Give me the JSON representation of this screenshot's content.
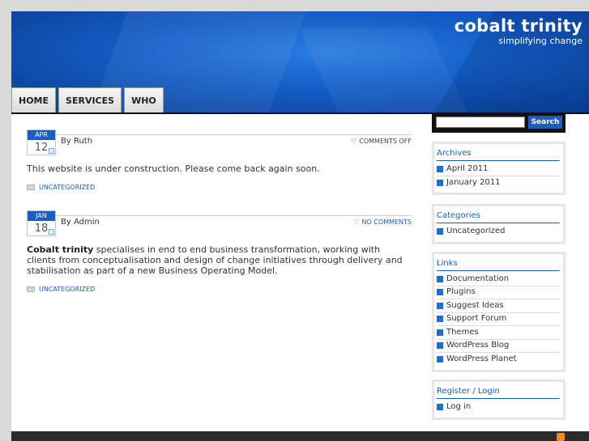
{
  "site": {
    "title": "cobalt trinity",
    "tagline": "simplifying change"
  },
  "nav": {
    "items": [
      "HOME",
      "SERVICES",
      "WHO"
    ]
  },
  "posts": [
    {
      "month": "APR",
      "day": "12",
      "author": "By Ruth",
      "comments": "COMMENTS OFF",
      "body": "This website is under construction.  Please come back again soon.",
      "category": "UNCATEGORIZED"
    },
    {
      "month": "JAN",
      "day": "18",
      "author": "By Admin",
      "comments": "NO COMMENTS",
      "body_bold": "Cobalt trinity",
      "body": " specialises in end to end business transformation, working with clients from conceptualisation and design of change initiatives through delivery and stabilisation as part of a new Business Operating Model.",
      "category": "UNCATEGORIZED"
    }
  ],
  "search": {
    "button": "Search",
    "placeholder": ""
  },
  "widgets": {
    "archives": {
      "title": "Archives",
      "items": [
        "April 2011",
        "January 2011"
      ]
    },
    "categories": {
      "title": "Categories",
      "items": [
        "Uncategorized"
      ]
    },
    "links": {
      "title": "Links",
      "items": [
        "Documentation",
        "Plugins",
        "Suggest Ideas",
        "Support Forum",
        "Themes",
        "WordPress Blog",
        "WordPress Planet"
      ]
    },
    "meta": {
      "title": "Register / Login",
      "items": [
        "Log in"
      ]
    }
  },
  "colors": {
    "accent": "#1a5fc0",
    "header": "#1460c8",
    "footer": "#2b2b2b"
  },
  "icons": {
    "calendar": "calendar-icon",
    "comment": "comment-bubble-icon",
    "folder": "folder-icon",
    "bullet": "square-bullet-icon",
    "rss": "rss-icon"
  }
}
